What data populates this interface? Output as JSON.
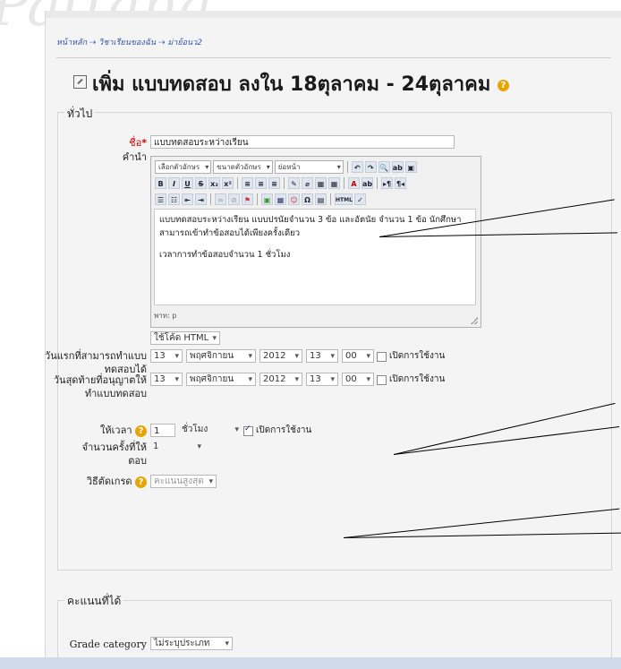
{
  "watermark": [
    "Pattana",
    "Pattana"
  ],
  "breadcrumb": "หน้าหลัก ⇢ วิชาเรียนของฉัน ⇢ ม่าย้อนว2",
  "title": "เพิ่ม แบบทดสอบ ลงใน 18ตุลาคม - 24ตุลาคม",
  "general": {
    "legend": "ทั่วไป",
    "name_label": "ชื่อ",
    "name_required": "*",
    "name_value": "แบบทดสอบระหว่างเรียน",
    "desc_label": "คำนำ",
    "toolbar": {
      "font_select": "เลือกตัวอักษร",
      "size_select": "ขนาดตัวอักษร",
      "heading_select": "ย่อหน้า",
      "buttons_row1": [
        "↶",
        "↷",
        "🔍",
        "ab",
        "▣"
      ],
      "buttons_row2": [
        "B",
        "I",
        "U",
        "S",
        "x₂",
        "x²",
        "≡",
        "≡",
        "≡",
        "✎",
        "⌀",
        "▦",
        "▦",
        "A",
        "ab",
        "▸¶",
        "¶◂"
      ],
      "buttons_row3": [
        "☰",
        "☷",
        "⇤",
        "⇥",
        "∞",
        "⊘",
        "⚑",
        "▣",
        "▦",
        "☺",
        "Ω",
        "▤",
        "HTML",
        "✓"
      ]
    },
    "editor_paragraphs": [
      "แบบทดสอบระหว่างเรียน แบบปรนัยจำนวน 3 ข้อ และอัตนัย จำนวน 1 ข้อ นักศึกษาสามารถเข้าทำข้อสอบได้เพียงครั้งเดียว",
      "เวลาการทำข้อสอบจำนวน 1 ชั่วโมง"
    ],
    "path_label": "พาท: p",
    "format_select": "ใช้โค้ด HTML",
    "open_label": "วันแรกที่สามารถทำแบบทดสอบได้",
    "close_label": "วันสุดท้ายที่อนุญาตให้ทำแบบทดสอบ",
    "date_open": {
      "day": "13",
      "month": "พฤศจิกายน",
      "year": "2012",
      "hour": "13",
      "minute": "00",
      "enable": "เปิดการใช้งาน"
    },
    "date_close": {
      "day": "13",
      "month": "พฤศจิกายน",
      "year": "2012",
      "hour": "13",
      "minute": "00",
      "enable": "เปิดการใช้งาน"
    },
    "timelimit_label": "ให้เวลา",
    "timelimit_value": "1",
    "timelimit_unit": "ชั่วโมง",
    "timelimit_enable": "เปิดการใช้งาน",
    "attempts_label": "จำนวนครั้งที่ให้ตอบ",
    "attempts_value": "1",
    "grading_label": "วิธีตัดเกรด",
    "grading_value": "คะแนนสูงสุด"
  },
  "grades": {
    "legend": "คะแนนที่ได้",
    "category_label": "Grade category",
    "category_value": "ไม่ระบุประเภท"
  },
  "help_icon_glyph": "?"
}
